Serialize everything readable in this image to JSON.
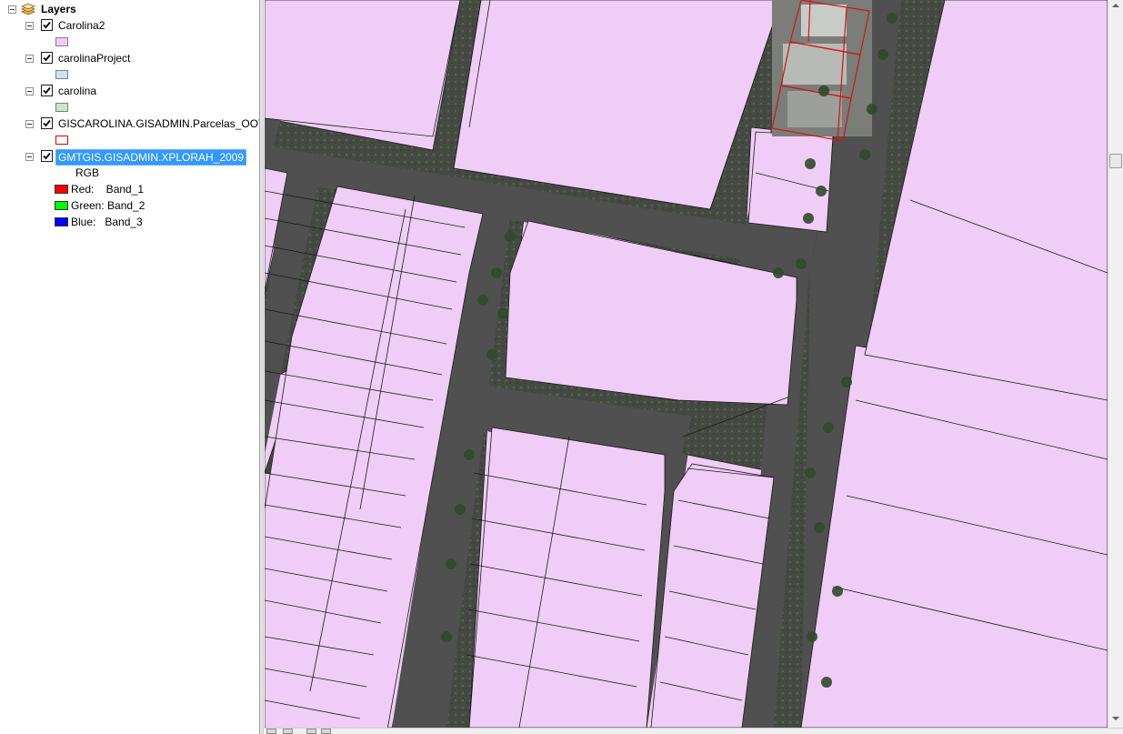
{
  "toc": {
    "root_label": "Layers",
    "layers": [
      {
        "name": "Carolina2",
        "checked": true,
        "symbol": {
          "fill": "#f0ccf5",
          "stroke": "#7f7f7f"
        }
      },
      {
        "name": "carolinaProject",
        "checked": true,
        "symbol": {
          "fill": "#cde3ef",
          "stroke": "#7f7f7f"
        }
      },
      {
        "name": "carolina",
        "checked": true,
        "symbol": {
          "fill": "#c9e8c8",
          "stroke": "#7f7f7f"
        }
      },
      {
        "name": "GISCAROLINA.GISADMIN.Parcelas_OOT",
        "checked": true,
        "symbol": {
          "fill": "#ffffff",
          "stroke": "#e00000"
        }
      },
      {
        "name": "GMTGIS.GISADMIN.XPLORAH_2009",
        "checked": true,
        "selected": true,
        "renderer_label": "RGB",
        "bands": [
          {
            "label": "Red:    Band_1",
            "color": "#ff0000"
          },
          {
            "label": "Green: Band_2",
            "color": "#00ff00"
          },
          {
            "label": "Blue:   Band_3",
            "color": "#0000ff"
          }
        ]
      }
    ]
  },
  "map": {
    "parcel_fill": "#efcdf6",
    "parcel_line": "#1a1a1a",
    "road_color": "#505050",
    "highlight_outline": "#d11515"
  }
}
